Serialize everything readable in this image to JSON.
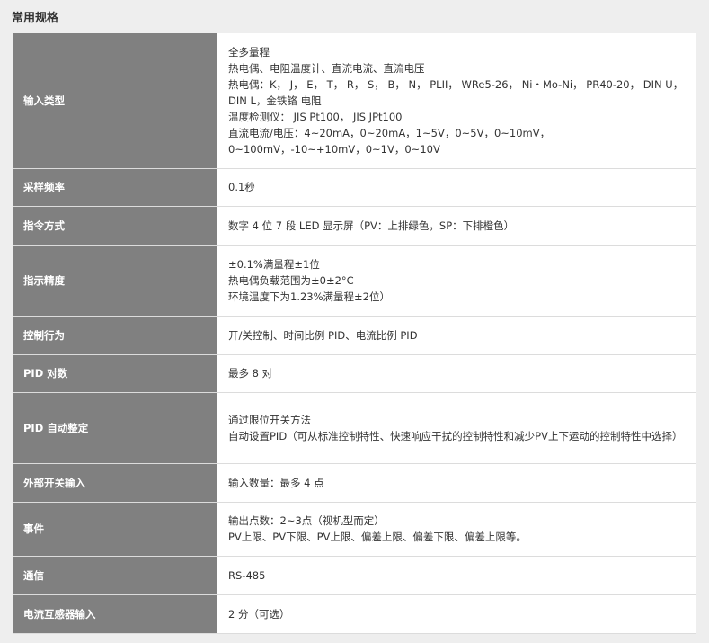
{
  "section_title": "常用规格",
  "rows": [
    {
      "label": "输入类型",
      "lines": [
        "全多量程",
        "热电偶、电阻温度计、直流电流、直流电压",
        "热电偶：K， J， E， T， R， S， B， N， PLII， WRe5-26， Ni・Mo-Ni， PR40-20， DIN U，DIN L，金铁铬 电阻",
        "温度检测仪： JIS Pt100， JIS JPt100",
        "直流电流/电压：4~20mA，0~20mA，1~5V，0~5V，0~10mV，",
        "0~100mV，-10~+10mV，0~1V，0~10V"
      ]
    },
    {
      "label": "采样频率",
      "lines": [
        "0.1秒"
      ]
    },
    {
      "label": "指令方式",
      "lines": [
        "数字 4 位 7 段 LED 显示屏（PV：上排绿色，SP：下排橙色）"
      ]
    },
    {
      "label": "指示精度",
      "lines": [
        "±0.1%满量程±1位",
        "热电偶负载范围为±0±2°C",
        "环境温度下为1.23%满量程±2位）"
      ]
    },
    {
      "label": "控制行为",
      "lines": [
        "开/关控制、时间比例 PID、电流比例 PID"
      ]
    },
    {
      "label": "PID 对数",
      "lines": [
        "最多 8 对"
      ]
    },
    {
      "label": "PID 自动整定",
      "lines": [
        "通过限位开关方法",
        "自动设置PID（可从标准控制特性、快速响应干扰的控制特性和减少PV上下运动的控制特性中选择）"
      ]
    },
    {
      "label": "外部开关输入",
      "lines": [
        "输入数量：最多 4 点"
      ]
    },
    {
      "label": "事件",
      "lines": [
        "输出点数：2~3点（视机型而定）",
        "PV上限、PV下限、PV上限、偏差上限、偏差下限、偏差上限等。"
      ]
    },
    {
      "label": "通信",
      "lines": [
        "RS-485"
      ]
    },
    {
      "label": "电流互感器输入",
      "lines": [
        "2 分（可选）"
      ]
    }
  ]
}
